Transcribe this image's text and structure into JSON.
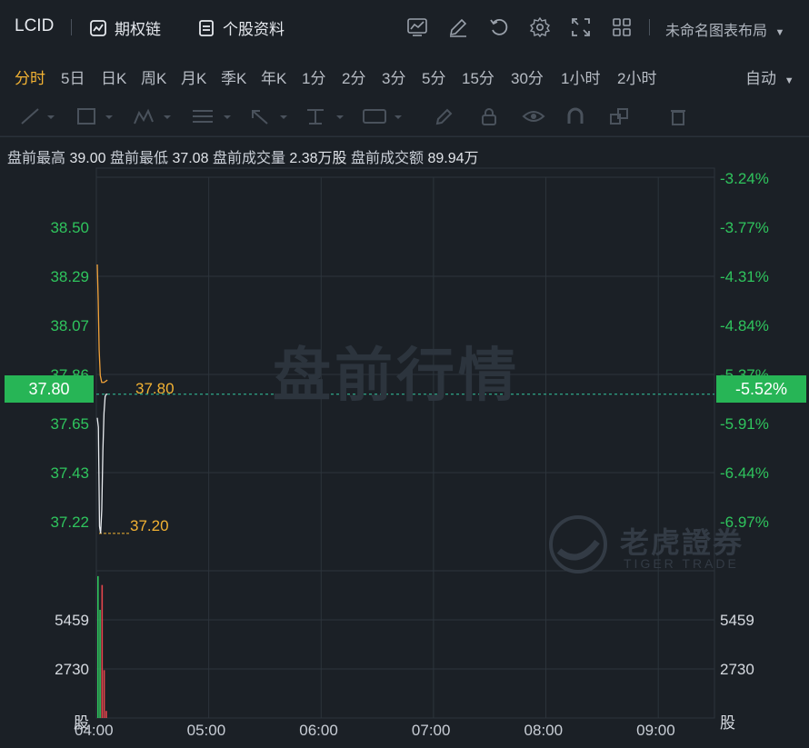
{
  "header": {
    "ticker": "LCID",
    "options_chain_label": "期权链",
    "stock_profile_label": "个股资料",
    "layout_label": "未命名图表布局"
  },
  "periods": [
    {
      "label": "分时",
      "active": true
    },
    {
      "label": "5日"
    },
    {
      "label": "日K"
    },
    {
      "label": "周K"
    },
    {
      "label": "月K"
    },
    {
      "label": "季K"
    },
    {
      "label": "年K"
    },
    {
      "label": "1分"
    },
    {
      "label": "2分"
    },
    {
      "label": "3分"
    },
    {
      "label": "5分"
    },
    {
      "label": "15分"
    },
    {
      "label": "30分"
    },
    {
      "label": "1小时"
    },
    {
      "label": "2小时"
    }
  ],
  "auto_label": "自动",
  "premarket": {
    "high_label": "盘前最高",
    "high": "39.00",
    "low_label": "盘前最低",
    "low": "37.08",
    "volume_label": "盘前成交量",
    "volume": "2.38万股",
    "turnover_label": "盘前成交额",
    "turnover": "89.94万"
  },
  "watermark": "盘前行情",
  "brand": {
    "cn": "老虎證券",
    "en": "TIGER TRADE"
  },
  "colors": {
    "up": "#2fc45d",
    "down": "#e5454c",
    "accent": "#f2b233",
    "background": "#1b2026"
  },
  "chart_data": {
    "type": "line",
    "x_ticks": [
      "04:00",
      "05:00",
      "06:00",
      "07:00",
      "08:00",
      "09:00"
    ],
    "price_ticks": [
      "38.50",
      "38.29",
      "38.07",
      "37.86",
      "37.65",
      "37.43",
      "37.22"
    ],
    "pct_ticks": [
      "-3.24%",
      "-3.77%",
      "-4.31%",
      "-4.84%",
      "-5.37%",
      "-5.91%",
      "-6.44%",
      "-6.97%"
    ],
    "current_price": "37.80",
    "current_pct": "-5.52%",
    "price_line_label": "37.80",
    "low_line_label": "37.20",
    "ylim": [
      37.09,
      38.72
    ],
    "price_series": {
      "x_minutes": [
        0,
        0.6,
        1.2,
        1.8,
        2.4,
        3.0,
        3.6,
        4.2,
        4.8,
        5.4
      ],
      "values": [
        37.7,
        37.66,
        37.24,
        37.21,
        37.31,
        37.56,
        37.72,
        37.79,
        37.8,
        37.8
      ]
    },
    "avg_series": {
      "x_minutes": [
        0,
        0.5,
        1.0,
        1.6,
        2.4,
        3.6,
        5.4
      ],
      "values": [
        38.35,
        38.2,
        37.99,
        37.88,
        37.85,
        37.85,
        37.86
      ]
    },
    "volume": {
      "ticks": [
        "5459",
        "2730"
      ],
      "unit": "股",
      "ylim": [
        0,
        8200
      ],
      "bars": [
        {
          "minute": 0,
          "value": 8000,
          "dir": "up"
        },
        {
          "minute": 1.1,
          "value": 6100,
          "dir": "up"
        },
        {
          "minute": 2.2,
          "value": 7500,
          "dir": "down"
        },
        {
          "minute": 3.3,
          "value": 2700,
          "dir": "down"
        },
        {
          "minute": 4.4,
          "value": 400,
          "dir": "down"
        }
      ]
    }
  }
}
